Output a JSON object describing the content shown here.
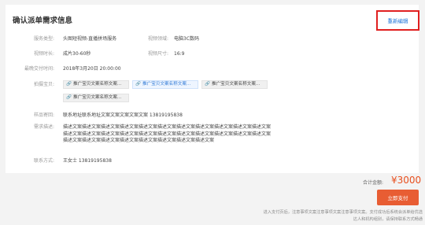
{
  "header": {
    "title": "确认派单需求信息",
    "reedit_label": "重新编辑"
  },
  "fields": {
    "service_type": {
      "label": "服务类型:",
      "value": "头图短视频-直播拼场服务"
    },
    "video_field": {
      "label": "视频领域:",
      "value": "电脑3C数码"
    },
    "video_duration": {
      "label": "视频时长:",
      "value": "成片30-60秒"
    },
    "video_size": {
      "label": "视频尺寸:",
      "value": "16:9"
    },
    "deadline": {
      "label": "最晚交付时间:",
      "value": "2018年3月20日  20:00:00"
    },
    "products": {
      "label": "拍摄宝贝:",
      "items": [
        "推广宝贝文案名称文案...",
        "推广宝贝文案名称文案...",
        "推广宝贝文案名称文案...",
        "推广宝贝文案名称文案..."
      ]
    },
    "sample_address": {
      "label": "样品寄回:",
      "value": "联系地址联系地址文案文案文案文案文案  13819195838"
    },
    "requirement": {
      "label": "需求描述:",
      "value": "描述文案描述文案描述文案描述文案描述文案描述文案描述文案描述文案描述文案描述文案描述文案描述文案描述文案描述文案描述文案描述文案描述文案描述文案描述文案描述文案描述文案描述文案描述文案描述文案描述文案描述文案描述文案描述文案描述文案描述文案"
    },
    "contact": {
      "label": "联系方式:",
      "value": "王女士  13819195838"
    }
  },
  "footer": {
    "total_label": "合计金额:",
    "total_amount": "¥3000",
    "pay_label": "立即支付",
    "notice": "进入支付页后，注意事项文案注意事项文案注意事项文案。支付成功后系统会派单给优选达人和机构组别，请保持联系方式畅通"
  },
  "icons": {
    "product_chip": "link-icon"
  },
  "colors": {
    "accent": "#1a73d9",
    "price": "#e8501f",
    "pay_button": "#e85d33",
    "highlight_box": "#e02020"
  }
}
